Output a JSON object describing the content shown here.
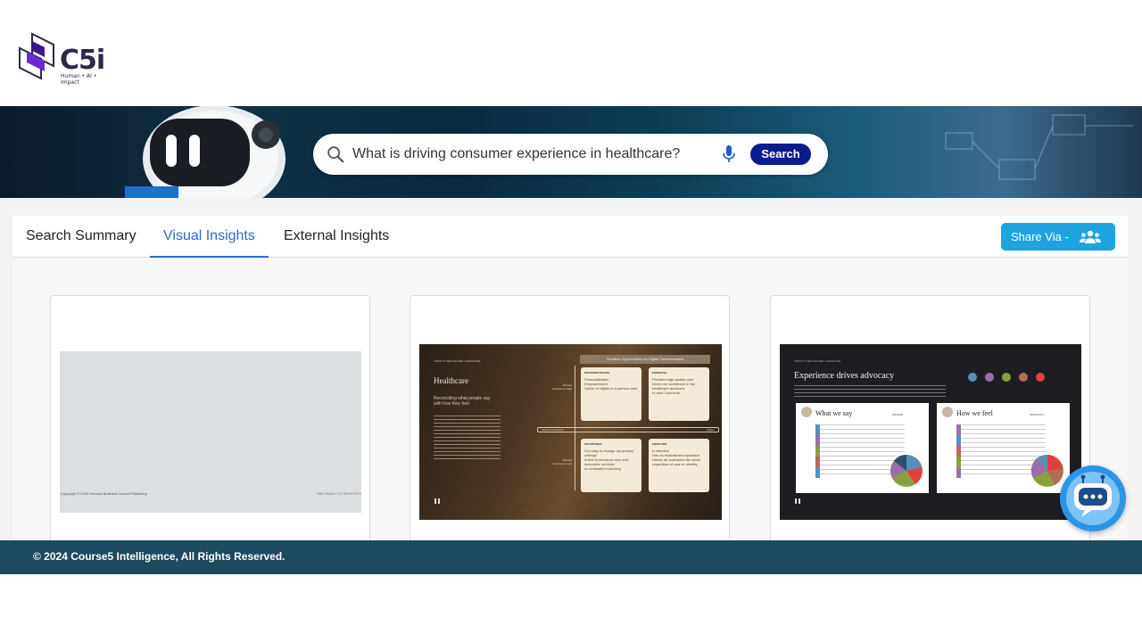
{
  "brand": {
    "logo_text": "C5i",
    "tagline": "Human • AI • Impact",
    "primary_color": "#0a1d8f",
    "accent_color": "#1ea3e0"
  },
  "search": {
    "query": "What is driving consumer experience in healthcare?",
    "button_label": "Search",
    "icon": "search-icon",
    "mic_icon": "mic-icon"
  },
  "tabs": [
    {
      "label": "Search Summary",
      "active": false
    },
    {
      "label": "Visual Insights",
      "active": true
    },
    {
      "label": "External Insights",
      "active": false
    }
  ],
  "share": {
    "label": "Share Via -",
    "icon": "users-icon"
  },
  "cards": [
    {
      "slide": {
        "footer_left": "Copyright © 2020 Harvard Business School Publishing",
        "footer_right": "HBR ANALYTIC SERVICES"
      }
    },
    {
      "slide": {
        "section": "TODAY'S HEALTHCARE LANDSCAPE",
        "title": "Healthcare",
        "subtitle": "Reconciling what people say with how they feel",
        "matrix_title": "Greatest Opportunities for Digital Transformation",
        "axis_x_left": "Stated Importance",
        "axis_x_right": "Higher",
        "axis_y_top": "Derived Importance High",
        "axis_y_bottom": "Derived Importance Low",
        "quadrants": [
          {
            "title": "DIFFERENTIATORS",
            "items": [
              "Personalization",
              "Empowerment",
              "Option of digital or in-person care"
            ]
          },
          {
            "title": "ESSENTIAL",
            "items": [
              "Provides high-quality care",
              "Gives me confidence in my healthcare decisions",
              "Is care I can trust"
            ]
          },
          {
            "title": "SITUATIONAL",
            "items": [
              "It is easy to change my privacy settings",
              "Is first to introduce new and innovative services",
              "Is constantly improving"
            ]
          },
          {
            "title": "EXPECTED",
            "items": [
              "Is effective",
              "Has an established reputation",
              "Values all customers the same regardless of race or identity"
            ]
          }
        ]
      }
    },
    {
      "slide": {
        "section": "TODAY'S HEALTHCARE LANDSCAPE",
        "title": "Experience drives advocacy",
        "left_panel_title": "What we say",
        "left_panel_tag": "CHOICE",
        "right_panel_title": "How we feel",
        "right_panel_tag": "ADVOCACY"
      }
    }
  ],
  "footer": {
    "copyright": "© 2024 Course5 Intelligence, All Rights Reserved."
  },
  "chatbot": {
    "icon": "chatbot-icon"
  }
}
